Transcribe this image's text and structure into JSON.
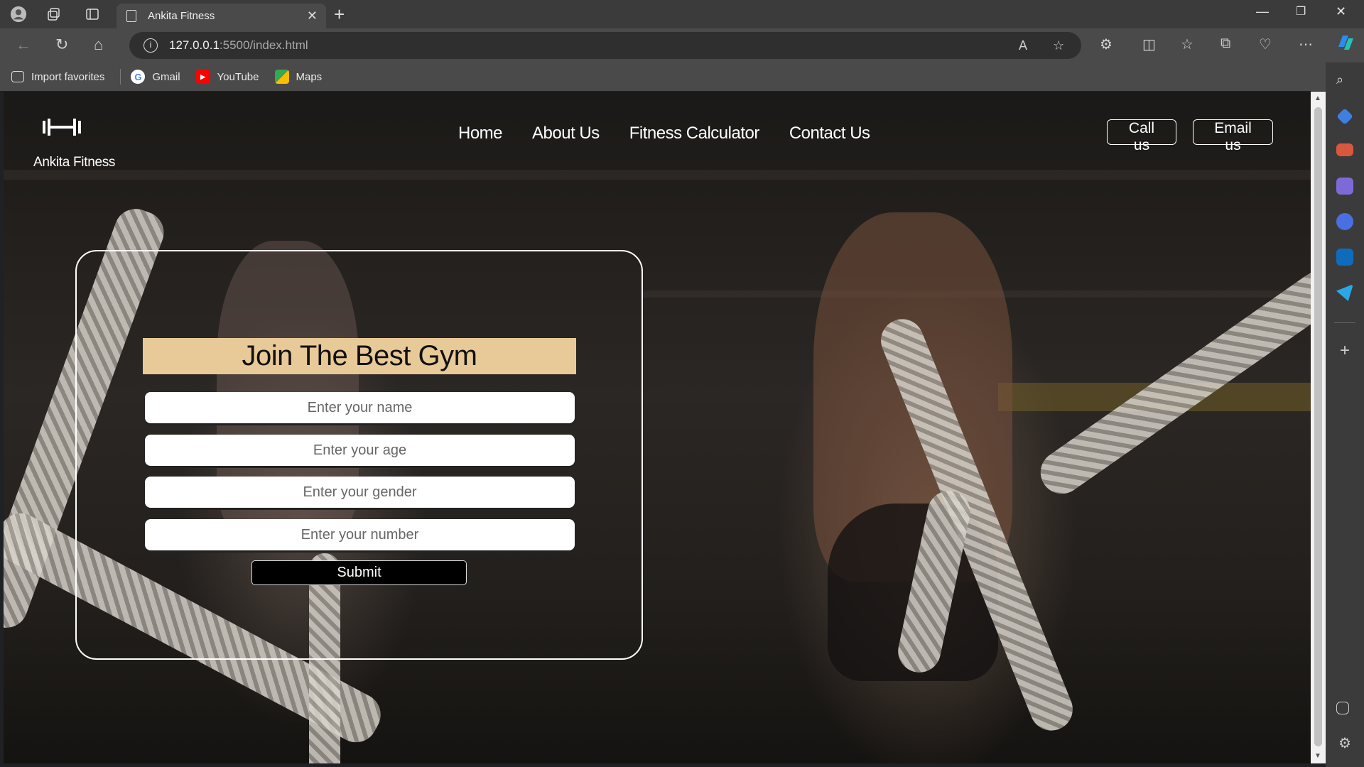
{
  "browser": {
    "tab_title": "Ankita Fitness",
    "url_host": "127.0.0.1",
    "url_path": ":5500/index.html",
    "favorites": [
      {
        "label": "Import favorites",
        "icon": "import-icon"
      },
      {
        "label": "Gmail",
        "icon": "google-icon"
      },
      {
        "label": "YouTube",
        "icon": "youtube-icon"
      },
      {
        "label": "Maps",
        "icon": "maps-icon"
      }
    ]
  },
  "site": {
    "brand": "Ankita Fitness",
    "nav": [
      "Home",
      "About Us",
      "Fitness Calculator",
      "Contact Us"
    ],
    "call_label": "Call us",
    "email_label": "Email us"
  },
  "form": {
    "title": "Join The Best Gym",
    "fields": [
      {
        "placeholder": "Enter your name",
        "value": ""
      },
      {
        "placeholder": "Enter your age",
        "value": ""
      },
      {
        "placeholder": "Enter your gender",
        "value": ""
      },
      {
        "placeholder": "Enter your number",
        "value": ""
      }
    ],
    "submit_label": "Submit"
  },
  "colors": {
    "title_bg": "#e8c998",
    "chrome_bg": "#3b3b3b"
  }
}
